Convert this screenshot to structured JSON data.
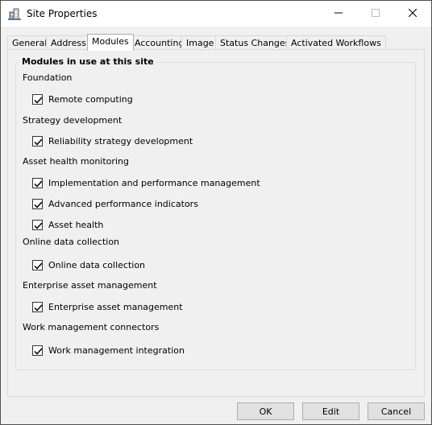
{
  "window": {
    "title": "Site Properties",
    "app_icon": "site-icon"
  },
  "caption_buttons": {
    "minimize": "minimize-icon",
    "maximize": "maximize-icon",
    "close": "close-icon"
  },
  "tabs": [
    {
      "label": "General"
    },
    {
      "label": "Address"
    },
    {
      "label": "Modules",
      "active": true
    },
    {
      "label": "Accounting"
    },
    {
      "label": "Image"
    },
    {
      "label": "Status Changes"
    },
    {
      "label": "Activated Workflows"
    }
  ],
  "modules": {
    "group_title": "Modules in use at this site",
    "sections": [
      {
        "title": "Foundation",
        "items": [
          {
            "label": "Remote computing",
            "checked": true
          }
        ]
      },
      {
        "title": "Strategy development",
        "items": [
          {
            "label": "Reliability strategy development",
            "checked": true
          }
        ]
      },
      {
        "title": "Asset health monitoring",
        "items": [
          {
            "label": "Implementation and performance management",
            "checked": true
          },
          {
            "label": "Advanced performance indicators",
            "checked": true
          },
          {
            "label": "Asset health",
            "checked": true
          }
        ]
      },
      {
        "title": "Online data collection",
        "items": [
          {
            "label": "Online data collection",
            "checked": true
          }
        ]
      },
      {
        "title": "Enterprise asset management",
        "items": [
          {
            "label": "Enterprise asset management",
            "checked": true
          }
        ]
      },
      {
        "title": "Work management connectors",
        "items": [
          {
            "label": "Work management integration",
            "checked": true
          }
        ]
      }
    ]
  },
  "buttons": {
    "ok": "OK",
    "edit": "Edit",
    "cancel": "Cancel"
  },
  "colors": {
    "window_bg": "#f0f0f0",
    "titlebar_bg": "#ffffff",
    "border": "#adadad"
  }
}
